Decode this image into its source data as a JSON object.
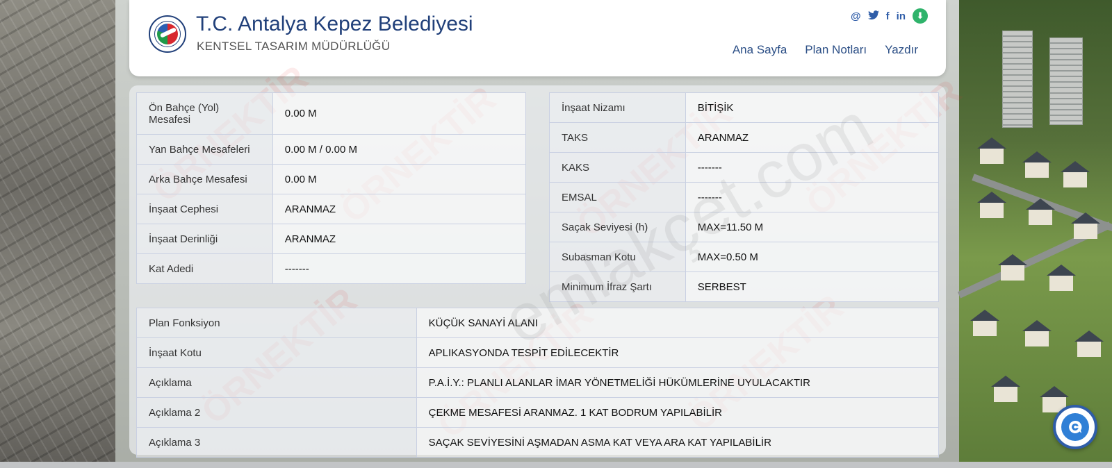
{
  "header": {
    "title": "T.C. Antalya Kepez Belediyesi",
    "subtitle": "KENTSEL TASARIM MÜDÜRLÜĞÜ",
    "logo_text": "KEPEZ BELEDİYESİ",
    "nav": [
      {
        "label": "Ana Sayfa"
      },
      {
        "label": "Plan Notları"
      },
      {
        "label": "Yazdır"
      }
    ],
    "social": [
      {
        "icon": "at-icon",
        "glyph": "@"
      },
      {
        "icon": "twitter-icon",
        "glyph": "🐦"
      },
      {
        "icon": "facebook-icon",
        "glyph": "f"
      },
      {
        "icon": "linkedin-icon",
        "glyph": "in"
      },
      {
        "icon": "download-icon",
        "glyph": "⬇"
      }
    ]
  },
  "left_table": [
    {
      "key": "Ön Bahçe (Yol) Mesafesi",
      "value": "0.00 M"
    },
    {
      "key": "Yan Bahçe Mesafeleri",
      "value": "0.00 M / 0.00 M"
    },
    {
      "key": "Arka Bahçe Mesafesi",
      "value": "0.00 M"
    },
    {
      "key": "İnşaat Cephesi",
      "value": "ARANMAZ"
    },
    {
      "key": "İnşaat Derinliği",
      "value": "ARANMAZ"
    },
    {
      "key": "Kat Adedi",
      "value": "-------"
    }
  ],
  "right_table": [
    {
      "key": "İnşaat Nizamı",
      "value": "BİTİŞİK"
    },
    {
      "key": "TAKS",
      "value": "ARANMAZ"
    },
    {
      "key": "KAKS",
      "value": "-------"
    },
    {
      "key": "EMSAL",
      "value": "-------"
    },
    {
      "key": "Saçak Seviyesi (h)",
      "value": "MAX=11.50 M"
    },
    {
      "key": "Subasman Kotu",
      "value": "MAX=0.50 M"
    },
    {
      "key": "Minimum İfraz Şartı",
      "value": "SERBEST"
    }
  ],
  "bottom_table": [
    {
      "key": "Plan Fonksiyon",
      "value": "KÜÇÜK SANAYİ ALANI"
    },
    {
      "key": "İnşaat Kotu",
      "value": "APLIKASYONDA TESPİT EDİLECEKTİR"
    },
    {
      "key": "Açıklama",
      "value": "P.A.İ.Y.: PLANLI ALANLAR İMAR YÖNETMELİĞİ HÜKÜMLERİNE UYULACAKTIR"
    },
    {
      "key": "Açıklama 2",
      "value": "ÇEKME MESAFESİ ARANMAZ. 1 KAT BODRUM YAPILABİLİR"
    },
    {
      "key": "Açıklama 3",
      "value": "SAÇAK SEVİYESİNİ AŞMADAN ASMA KAT VEYA ARA KAT YAPILABİLİR"
    }
  ],
  "watermarks": {
    "main": "emlakçet.com",
    "stamp": "ÖRNEKTİR"
  }
}
